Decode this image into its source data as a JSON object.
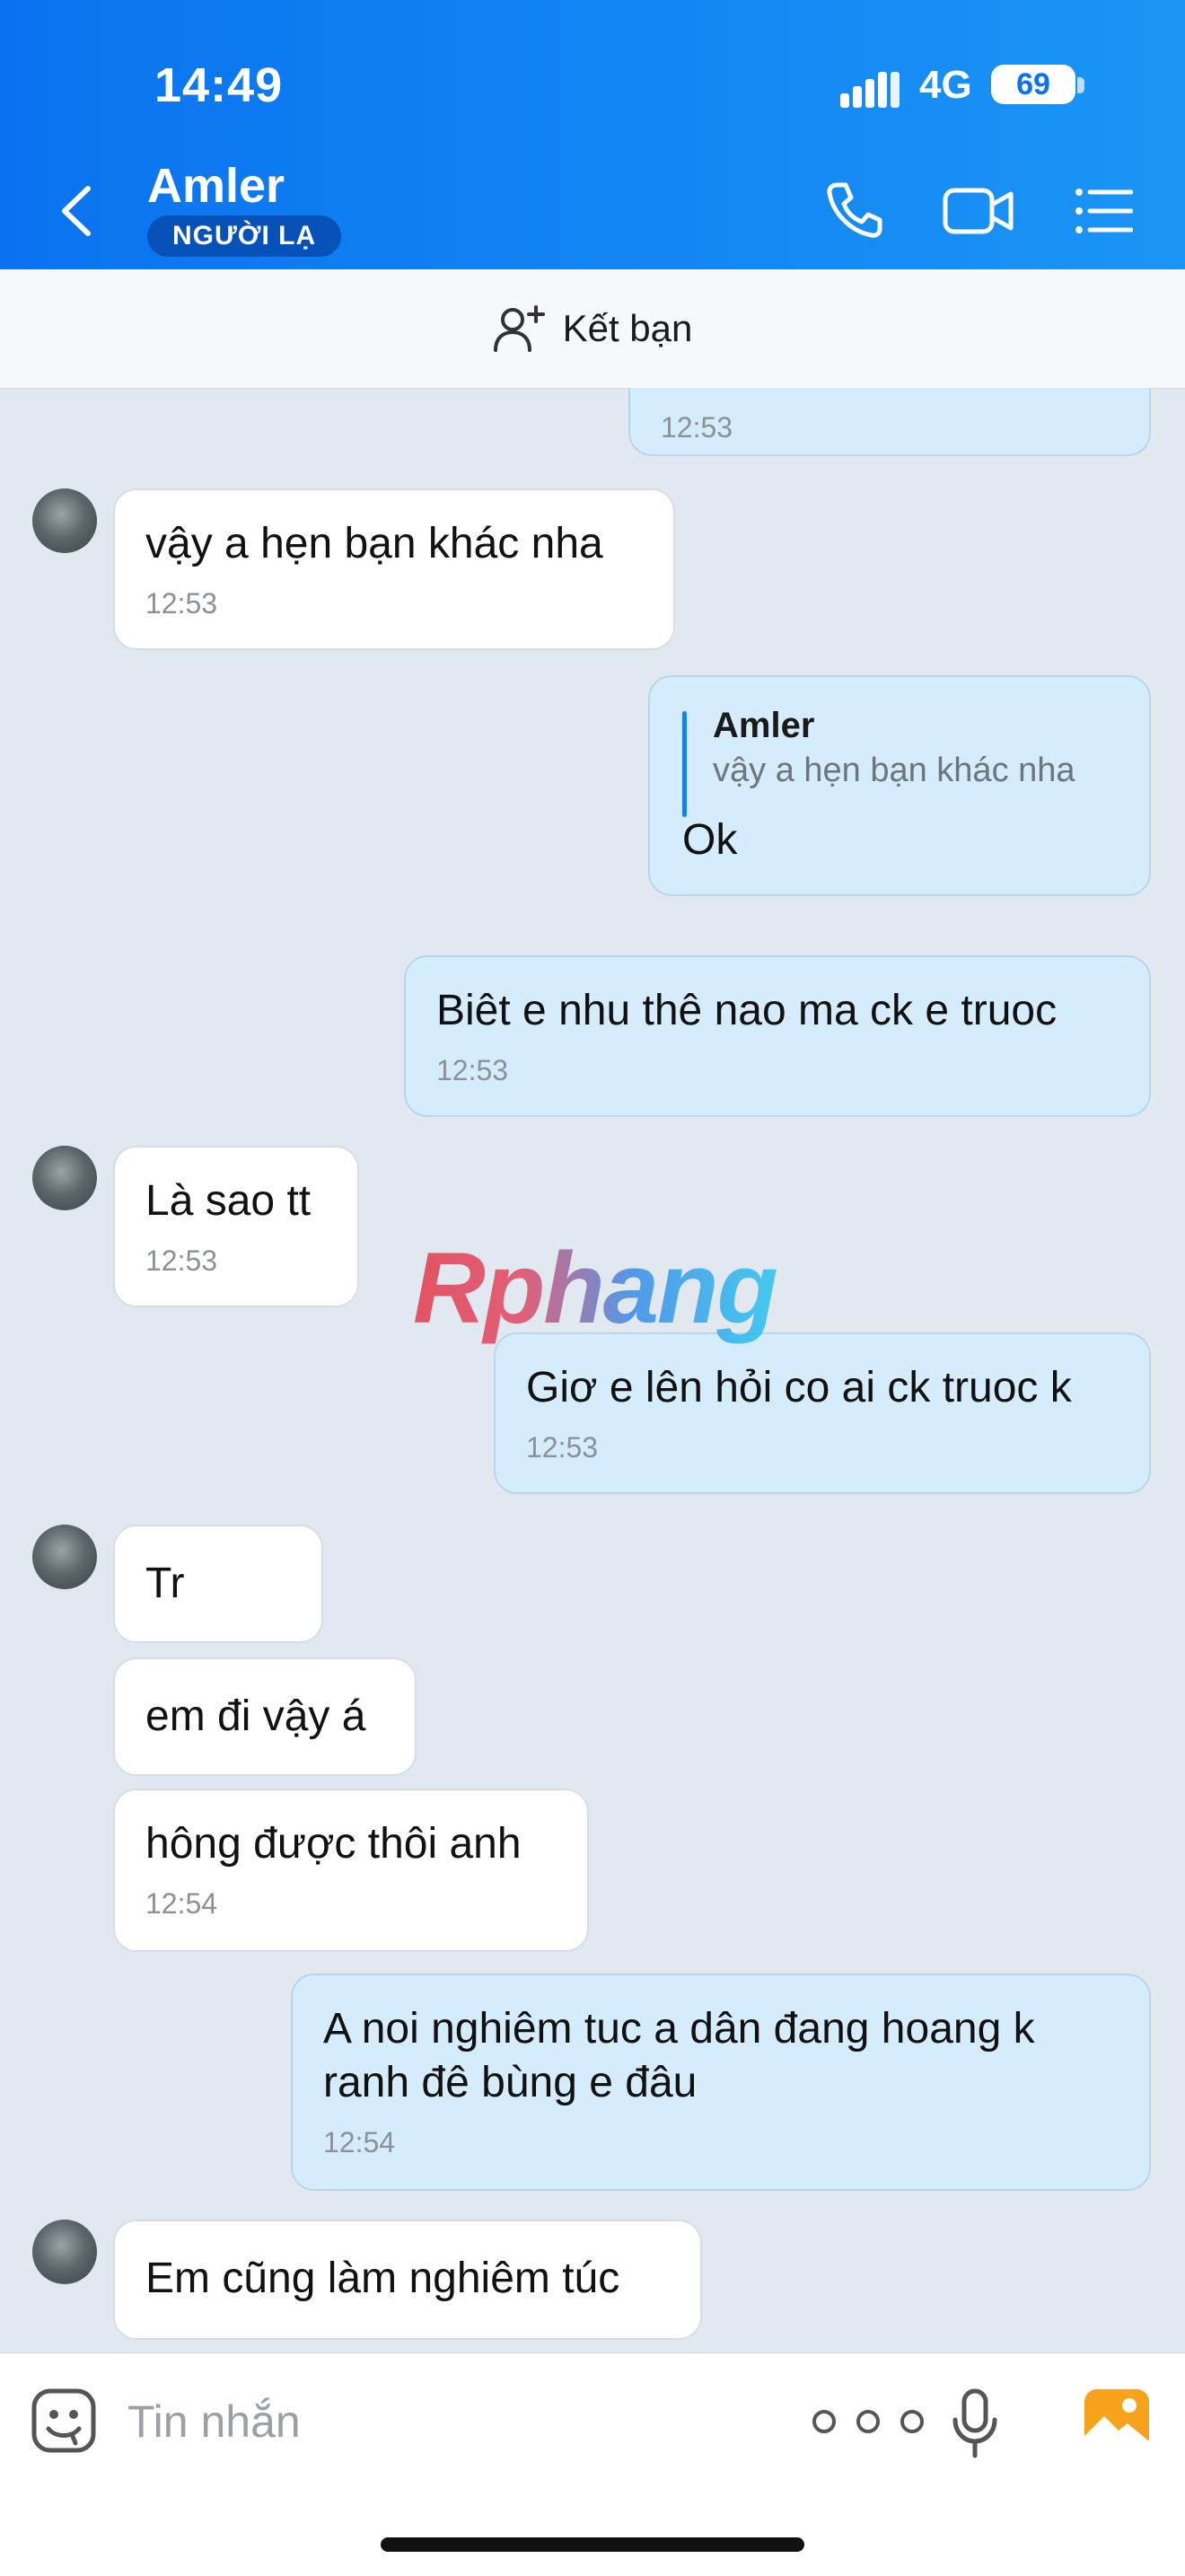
{
  "status_bar": {
    "time": "14:49",
    "network": "4G",
    "battery": "69"
  },
  "header": {
    "name": "Amler",
    "badge": "NGƯỜI LẠ"
  },
  "friend_bar": {
    "label": "Kết bạn"
  },
  "messages": [
    {
      "side": "out",
      "text": "",
      "time": "12:53"
    },
    {
      "side": "in",
      "text": "vậy a hẹn bạn khác nha",
      "time": "12:53"
    },
    {
      "side": "out",
      "quote_author": "Amler",
      "quote_text": "vậy a hẹn bạn khác nha",
      "text": "Ok"
    },
    {
      "side": "out",
      "text": "Biêt e nhu thê nao ma ck e truoc",
      "time": "12:53"
    },
    {
      "side": "in",
      "text": "Là sao tt",
      "time": "12:53"
    },
    {
      "side": "out",
      "text": "Giơ e lên hỏi co ai ck truoc k",
      "time": "12:53"
    },
    {
      "side": "in",
      "text": "Tr"
    },
    {
      "side": "in",
      "text": "em đi vậy á"
    },
    {
      "side": "in",
      "text": "hông được thôi anh",
      "time": "12:54"
    },
    {
      "side": "out",
      "text": "A noi nghiêm tuc a dân đang hoang k ranh đê bùng e đâu",
      "time": "12:54"
    },
    {
      "side": "in",
      "text": "Em cũng làm nghiêm túc"
    }
  ],
  "watermark": "Rphang",
  "input": {
    "placeholder": "Tin nhắn"
  },
  "icons": {
    "back": "chevron-left-icon",
    "call": "phone-icon",
    "video": "video-icon",
    "menu": "list-menu-icon",
    "add_friend": "add-user-icon",
    "sticker": "sticker-icon",
    "more": "more-dots-icon",
    "mic": "microphone-icon",
    "image": "image-icon"
  },
  "colors": {
    "header_start": "#0a72f0",
    "header_end": "#1a95f5",
    "outgoing_bubble": "#d4ecfb",
    "incoming_bubble": "#ffffff",
    "chat_bg": "#e2e8f0"
  }
}
